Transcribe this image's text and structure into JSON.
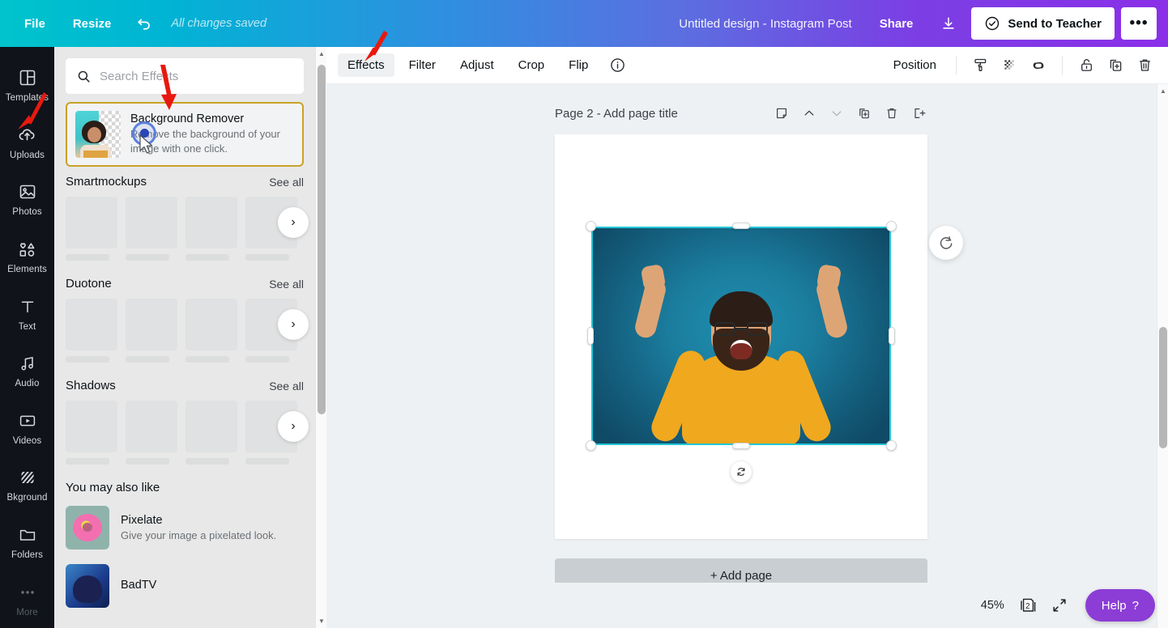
{
  "header": {
    "file_label": "File",
    "resize_label": "Resize",
    "undo_icon": "undo-arrow-icon",
    "saved_status": "All changes saved",
    "design_title": "Untitled design - Instagram Post",
    "share_label": "Share",
    "download_icon": "download-icon",
    "send_teacher_label": "Send to Teacher",
    "send_teacher_icon": "check-circle-icon",
    "more_label": "•••"
  },
  "rail": {
    "items": [
      {
        "label": "Templates",
        "icon": "templates-grid-icon"
      },
      {
        "label": "Uploads",
        "icon": "cloud-upload-icon"
      },
      {
        "label": "Photos",
        "icon": "photo-image-icon"
      },
      {
        "label": "Elements",
        "icon": "shapes-elements-icon"
      },
      {
        "label": "Text",
        "icon": "text-t-icon"
      },
      {
        "label": "Audio",
        "icon": "music-note-icon"
      },
      {
        "label": "Videos",
        "icon": "video-play-icon"
      },
      {
        "label": "Bkground",
        "icon": "hatched-background-icon"
      },
      {
        "label": "Folders",
        "icon": "folder-icon"
      },
      {
        "label": "More",
        "icon": "ellipsis-icon"
      }
    ]
  },
  "panel": {
    "search_placeholder": "Search Effects",
    "search_icon": "search-icon",
    "featured": {
      "title": "Background Remover",
      "description": "Remove the background of your image with one click.",
      "thumb_icon": "background-remover-thumbnail"
    },
    "sections": [
      {
        "title": "Smartmockups",
        "see_all": "See all",
        "tiles": 4,
        "next_icon": "chevron-right-icon"
      },
      {
        "title": "Duotone",
        "see_all": "See all",
        "tiles": 4,
        "next_icon": "chevron-right-icon"
      },
      {
        "title": "Shadows",
        "see_all": "See all",
        "tiles": 4,
        "next_icon": "chevron-right-icon"
      }
    ],
    "also_like": {
      "title": "You may also like",
      "items": [
        {
          "name": "Pixelate",
          "description": "Give your image a pixelated look.",
          "thumb": "donut-thumbnail"
        },
        {
          "name": "BadTV",
          "description": "",
          "thumb": "badtv-thumbnail"
        }
      ]
    }
  },
  "editor_toolbar": {
    "tabs": [
      {
        "label": "Effects",
        "active": true
      },
      {
        "label": "Filter",
        "active": false
      },
      {
        "label": "Adjust",
        "active": false
      },
      {
        "label": "Crop",
        "active": false
      },
      {
        "label": "Flip",
        "active": false
      }
    ],
    "info_icon": "info-circle-icon",
    "position_label": "Position",
    "icons": [
      {
        "name": "copy-style-roller-icon"
      },
      {
        "name": "transparency-checker-icon"
      },
      {
        "name": "link-icon"
      },
      {
        "name": "lock-open-icon"
      },
      {
        "name": "duplicate-icon"
      },
      {
        "name": "trash-icon"
      }
    ]
  },
  "canvas": {
    "page_title": "Page 2 - Add page title",
    "page_tools": [
      {
        "name": "notes-icon"
      },
      {
        "name": "move-up-icon"
      },
      {
        "name": "move-down-icon"
      },
      {
        "name": "duplicate-page-icon"
      },
      {
        "name": "delete-page-icon"
      },
      {
        "name": "export-page-icon"
      }
    ],
    "side_fab_icon": "rotate-add-icon",
    "rotate_handle_icon": "rotate-icon",
    "add_page_label": "+ Add page",
    "selection": {
      "border_color": "#22c6d6",
      "image_alt": "cheering-bearded-man-photo"
    }
  },
  "zoombar": {
    "zoom_level": "45%",
    "page_count": "2",
    "page_count_icon": "pages-stack-icon",
    "fullscreen_icon": "expand-arrows-icon",
    "help_label": "Help",
    "help_suffix": "?"
  },
  "annotations": {
    "arrow_color": "#e8190f",
    "arrows": [
      {
        "target": "uploads-rail-item"
      },
      {
        "target": "background-remover-card"
      },
      {
        "target": "effects-tab"
      }
    ],
    "cursor": {
      "target": "background-remover-card"
    }
  }
}
